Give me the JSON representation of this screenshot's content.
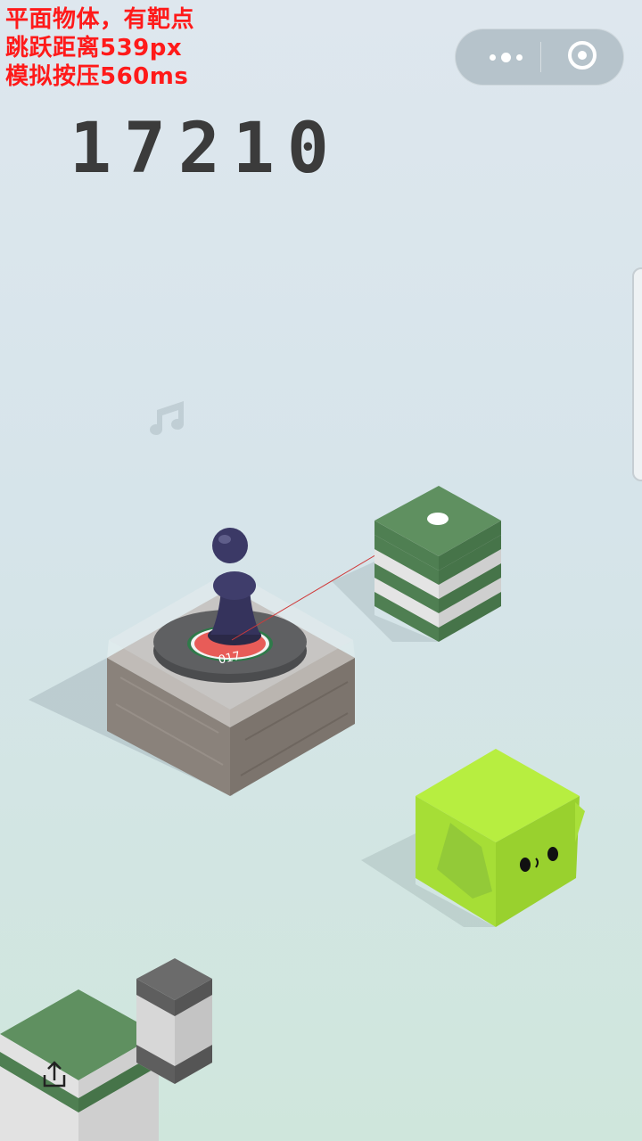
{
  "debug": {
    "line1": "平面物体，有靶点",
    "line2": "跳跃距离539px",
    "line3": "模拟按压560ms"
  },
  "score": "17210",
  "target_label": "017",
  "icons": {
    "more": "more-dots-icon",
    "close": "capsule-close-icon",
    "music": "music-note-icon",
    "share": "share-icon"
  },
  "colors": {
    "debug_text": "#ff1a1a",
    "score": "#3b3b3b",
    "player": "#35335c",
    "wood_top": "#a9a39d",
    "green_top": "#5f9060",
    "lime_block": "#b7ee40",
    "target_red": "#e85c58"
  }
}
